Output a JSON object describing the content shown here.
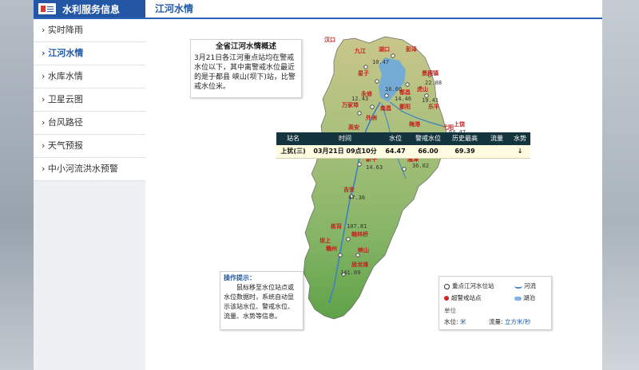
{
  "header": {
    "title": "水利服务信息",
    "active_tab": "江河水情"
  },
  "sidebar": {
    "items": [
      {
        "label": "› 实时降雨",
        "active": false
      },
      {
        "label": "› 江河水情",
        "active": true
      },
      {
        "label": "› 水库水情",
        "active": false
      },
      {
        "label": "› 卫星云图",
        "active": false
      },
      {
        "label": "› 台风路径",
        "active": false
      },
      {
        "label": "› 天气预报",
        "active": false
      },
      {
        "label": "› 中小河流洪水预警",
        "active": false
      }
    ]
  },
  "overview": {
    "title": "全省江河水情概述",
    "text": "3月21日各江河重点站均在警戒水位以下，其中离警戒水位最近的是于都县 峡山(坝下)站，比警戒水位米。"
  },
  "table": {
    "headers": [
      "站名",
      "时间",
      "水位",
      "警戒水位",
      "历史最高",
      "流量",
      "水势"
    ],
    "row": {
      "station": "上犹(三)",
      "time": "03月21日 09点10分",
      "level": "64.47",
      "warning": "66.00",
      "history": "69.39",
      "flow": "",
      "trend": "↓"
    }
  },
  "map_labels": {
    "places": [
      "汉口",
      "九江",
      "湖口",
      "彭泽",
      "星子",
      "都昌",
      "景德镇",
      "万家埠",
      "永修",
      "南昌",
      "鄱阳",
      "乐平",
      "高安",
      "外洲",
      "虎山",
      "上饶",
      "梅港",
      "弋阳",
      "新干",
      "鹰潭",
      "吉安",
      "栋背",
      "坝上",
      "赣州",
      "峡山",
      "翰林桥",
      "居龙滩"
    ],
    "values": [
      "10.47",
      "12.43",
      "16.60",
      "14.46",
      "22.08",
      "19.41",
      "64.47",
      "14.63",
      "36.02",
      "47.36",
      "107.81",
      "141.09"
    ]
  },
  "tips": {
    "title": "操作提示：",
    "text": "鼠标移至水位站点或水位数据时，系统自动显示该站水位、警戒水位、流量、水势等信息。"
  },
  "legend": {
    "key_station": "重点江河水位站",
    "over_warning": "超警戒站点",
    "river": "河流",
    "lake": "湖泊",
    "unit_title": "单位",
    "level_label": "水位:",
    "level_unit": "米",
    "flow_label": "流量:",
    "flow_unit": "立方米/秒"
  },
  "colors": {
    "header_blue": "#2456a6",
    "table_header": "#14343d",
    "map_green": "#8cb86a",
    "water": "#6ba8de"
  }
}
